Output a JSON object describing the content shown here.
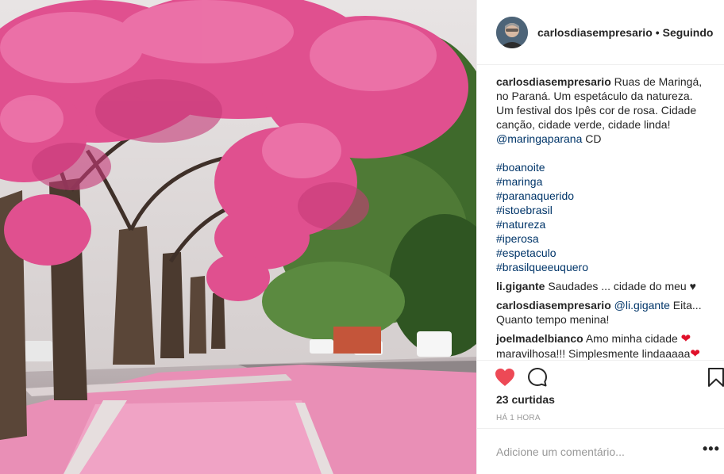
{
  "post": {
    "author": "carlosdiasempresario",
    "separator": "•",
    "follow_status": "Seguindo",
    "image_description_icon": "photo-pink-ipe-trees",
    "caption": {
      "user": "carlosdiasempresario",
      "text": " Ruas de Maringá, no Paraná. Um espetáculo da natureza. Um festival dos Ipês cor de rosa. Cidade canção, cidade verde, cidade linda! ",
      "mention": "@maringaparana",
      "suffix": " CD",
      "hashtags": [
        "#boanoite",
        "#maringa",
        "#paranaquerido",
        "#istoebrasil",
        "#natureza",
        "#iperosa",
        "#espetaculo",
        "#brasilqueeuquero"
      ]
    },
    "comments": [
      {
        "user": "li.gigante",
        "text": " Saudades ... cidade do meu ♥"
      },
      {
        "user": "carlosdiasempresario",
        "mention": "@li.gigante",
        "text": " Eita... Quanto tempo menina!"
      },
      {
        "user": "joelmadelbianco",
        "text": " Amo minha cidade ",
        "text2": " maravilhosa!!! Simplesmente lindaaaaa"
      }
    ],
    "likes": "23 curtidas",
    "timestamp": "HÁ 1 HORA",
    "add_comment_placeholder": "Adicione um comentário...",
    "more_label": "•••",
    "liked": true,
    "colors": {
      "heart": "#ed4956",
      "link": "#003569",
      "muted": "#999999"
    }
  }
}
